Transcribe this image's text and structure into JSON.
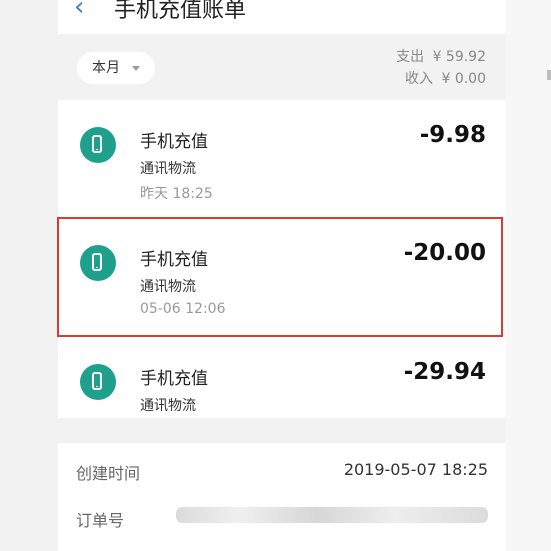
{
  "header": {
    "title": "手机充值账单"
  },
  "summary": {
    "period_label": "本月",
    "expense_label": "支出",
    "expense_value": "¥ 59.92",
    "income_label": "收入",
    "income_value": "¥ 0.00"
  },
  "transactions": [
    {
      "title": "手机充值",
      "merchant": "通讯物流",
      "time": "昨天  18:25",
      "amount": "-9.98"
    },
    {
      "title": "手机充值",
      "merchant": "通讯物流",
      "time": "05-06  12:06",
      "amount": "-20.00"
    },
    {
      "title": "手机充值",
      "merchant": "通讯物流",
      "time": "",
      "amount": "-29.94"
    }
  ],
  "detail": {
    "created_label": "创建时间",
    "created_value": "2019-05-07 18:25",
    "order_label": "订单号"
  },
  "colors": {
    "accent": "#3a7fd6",
    "icon_bg": "#1fa08d",
    "highlight": "#e0392f"
  },
  "icons": [
    "back-icon",
    "phone-icon",
    "chevron-down-icon"
  ]
}
